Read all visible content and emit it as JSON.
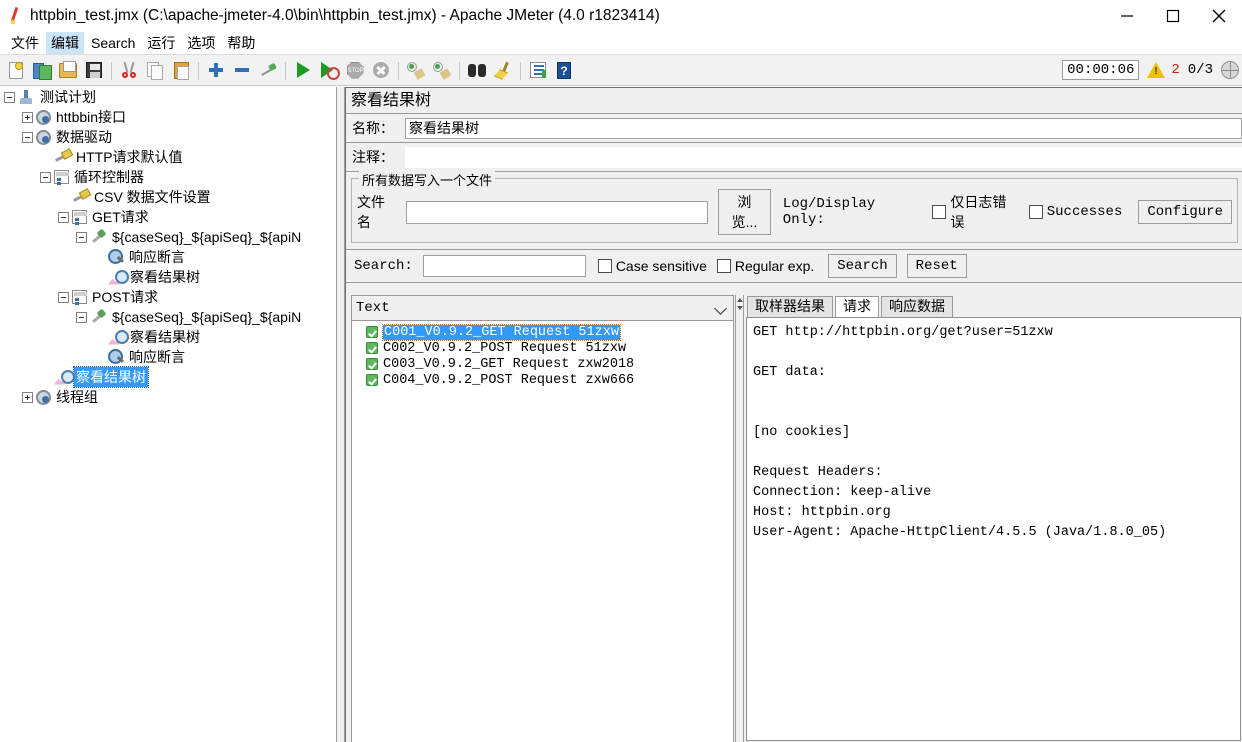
{
  "window": {
    "title": "httpbin_test.jmx (C:\\apache-jmeter-4.0\\bin\\httpbin_test.jmx) - Apache JMeter (4.0 r1823414)",
    "app_icon": "jmeter-icon",
    "minimize": "–",
    "maximize": "□",
    "close": "×"
  },
  "menu": {
    "items": [
      {
        "label": "文件",
        "highlighted": false
      },
      {
        "label": "编辑",
        "highlighted": true
      },
      {
        "label": "Search",
        "highlighted": false
      },
      {
        "label": "运行",
        "highlighted": false
      },
      {
        "label": "选项",
        "highlighted": false
      },
      {
        "label": "帮助",
        "highlighted": false
      }
    ]
  },
  "toolbar": {
    "buttons": [
      {
        "name": "new-icon"
      },
      {
        "name": "templates-icon"
      },
      {
        "name": "open-icon"
      },
      {
        "name": "save-icon"
      },
      {
        "name": "cut-icon"
      },
      {
        "name": "copy-icon"
      },
      {
        "name": "paste-icon"
      },
      {
        "name": "add-icon"
      },
      {
        "name": "remove-icon"
      },
      {
        "name": "toggle-icon"
      },
      {
        "name": "start-icon"
      },
      {
        "name": "start-no-pauses-icon"
      },
      {
        "name": "stop-icon"
      },
      {
        "name": "shutdown-icon"
      },
      {
        "name": "clear-icon"
      },
      {
        "name": "clear-all-icon"
      },
      {
        "name": "search-icon"
      },
      {
        "name": "search-reset-icon"
      },
      {
        "name": "function-helper-icon"
      },
      {
        "name": "help-icon"
      }
    ],
    "timer": "00:00:06",
    "warning_count": "2",
    "thread_counts": "0/3",
    "stop_label": "STOP",
    "help_label": "?",
    "warning_glyph": "!"
  },
  "tree": {
    "nodes": [
      {
        "label": "测试计划",
        "indent": 0,
        "expander": "minus",
        "icon": "test-plan-icon",
        "selected": false
      },
      {
        "label": "httbbin接口",
        "indent": 1,
        "expander": "plus",
        "icon": "thread-group-icon",
        "selected": false
      },
      {
        "label": "数据驱动",
        "indent": 1,
        "expander": "minus",
        "icon": "thread-group-icon",
        "selected": false
      },
      {
        "label": "HTTP请求默认值",
        "indent": 2,
        "expander": "none",
        "icon": "config-element-icon",
        "selected": false
      },
      {
        "label": "循环控制器",
        "indent": 2,
        "expander": "minus",
        "icon": "controller-icon",
        "selected": false
      },
      {
        "label": "CSV 数据文件设置",
        "indent": 3,
        "expander": "none",
        "icon": "config-element-icon",
        "selected": false
      },
      {
        "label": "GET请求",
        "indent": 3,
        "expander": "minus",
        "icon": "controller-icon",
        "selected": false
      },
      {
        "label": "${caseSeq}_${apiSeq}_${apiN",
        "indent": 4,
        "expander": "minus",
        "icon": "http-sampler-icon",
        "selected": false
      },
      {
        "label": "响应断言",
        "indent": 5,
        "expander": "none",
        "icon": "assertion-icon",
        "selected": false
      },
      {
        "label": "察看结果树",
        "indent": 5,
        "expander": "none",
        "icon": "view-results-tree-icon",
        "selected": false
      },
      {
        "label": "POST请求",
        "indent": 3,
        "expander": "minus",
        "icon": "controller-icon",
        "selected": false
      },
      {
        "label": "${caseSeq}_${apiSeq}_${apiN",
        "indent": 4,
        "expander": "minus",
        "icon": "http-sampler-icon",
        "selected": false
      },
      {
        "label": "察看结果树",
        "indent": 5,
        "expander": "none",
        "icon": "view-results-tree-icon",
        "selected": false
      },
      {
        "label": "响应断言",
        "indent": 5,
        "expander": "none",
        "icon": "assertion-icon",
        "selected": false
      },
      {
        "label": "察看结果树",
        "indent": 2,
        "expander": "none",
        "icon": "view-results-tree-icon",
        "selected": true
      },
      {
        "label": "线程组",
        "indent": 1,
        "expander": "plus",
        "icon": "thread-group-icon",
        "selected": false
      }
    ]
  },
  "panel": {
    "title": "察看结果树",
    "name_label": "名称：",
    "name_value": "察看结果树",
    "comment_label": "注释：",
    "comment_value": "",
    "file_group": {
      "title": "所有数据写入一个文件",
      "filename_label": "文件名",
      "filename_value": "",
      "browse_label": "浏览...",
      "log_display_label": "Log/Display Only:",
      "errors_label": "仅日志错误",
      "errors_checked": false,
      "successes_label": "Successes",
      "successes_checked": false,
      "configure_label": "Configure"
    },
    "search": {
      "label": "Search:",
      "value": "",
      "case_sensitive_label": "Case sensitive",
      "case_sensitive_checked": false,
      "regex_label": "Regular exp.",
      "regex_checked": false,
      "search_button": "Search",
      "reset_button": "Reset"
    },
    "results": {
      "renderer_selected": "Text",
      "items": [
        {
          "label": "C001_V0.9.2_GET Request 51zxw",
          "status": "success",
          "selected": true
        },
        {
          "label": "C002_V0.9.2_POST Request 51zxw",
          "status": "success",
          "selected": false
        },
        {
          "label": "C003_V0.9.2_GET Request zxw2018",
          "status": "success",
          "selected": false
        },
        {
          "label": "C004_V0.9.2_POST Request zxw666",
          "status": "success",
          "selected": false
        }
      ]
    },
    "detail_tabs": [
      {
        "label": "取样器结果",
        "active": false
      },
      {
        "label": "请求",
        "active": true
      },
      {
        "label": "响应数据",
        "active": false
      }
    ],
    "detail_body": [
      "GET http://httpbin.org/get?user=51zxw",
      "",
      "GET data:",
      "",
      "",
      "[no cookies]",
      "",
      "Request Headers:",
      "Connection: keep-alive",
      "Host: httpbin.org",
      "User-Agent: Apache-HttpClient/4.5.5 (Java/1.8.0_05)"
    ]
  },
  "colors": {
    "selection": "#3399ff",
    "success": "#5fb85f",
    "warning": "#f2c200",
    "error_text": "#cc2020",
    "panel_bg": "#f0f0f0"
  }
}
